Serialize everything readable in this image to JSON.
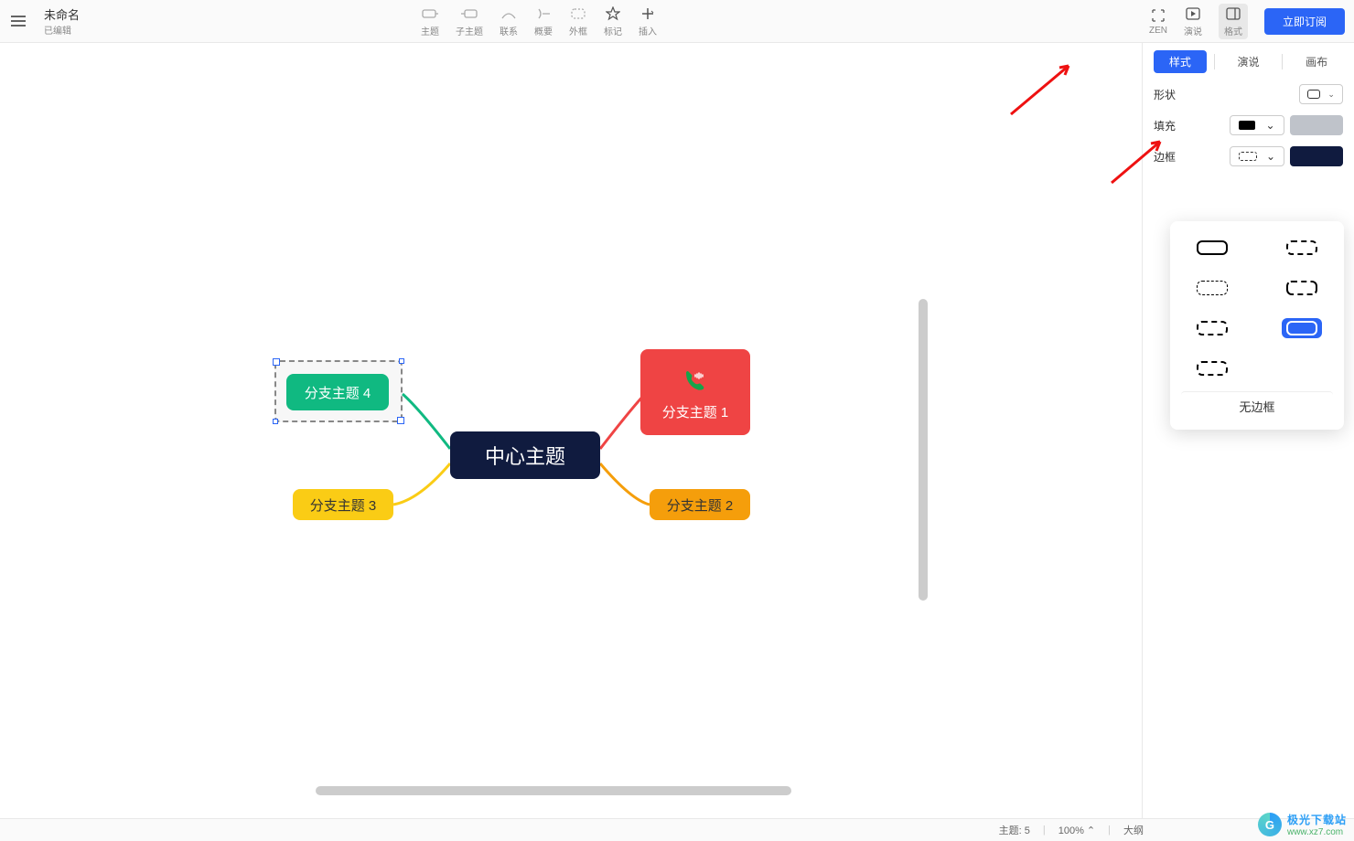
{
  "window": {
    "minimize": "—",
    "maximize": "▢",
    "close": "✕"
  },
  "header": {
    "title": "未命名",
    "subtitle": "已编辑"
  },
  "toolbar": {
    "topic": "主题",
    "subtopic": "子主题",
    "relation": "联系",
    "summary": "概要",
    "boundary": "外框",
    "marker": "标记",
    "insert": "插入"
  },
  "toolbar_right": {
    "zen": "ZEN",
    "present": "演说",
    "format": "格式",
    "subscribe": "立即订阅"
  },
  "panel": {
    "tabs": {
      "style": "样式",
      "present": "演说",
      "canvas": "画布"
    },
    "shape_label": "形状",
    "fill_label": "填充",
    "border_label": "边框"
  },
  "popover": {
    "no_border": "无边框"
  },
  "mindmap": {
    "center": "中心主题",
    "branch1": "分支主题 1",
    "branch2": "分支主题 2",
    "branch3": "分支主题 3",
    "branch4": "分支主题 4"
  },
  "statusbar": {
    "topics_label": "主题:",
    "topics_count": "5",
    "zoom": "100%",
    "outline": "大纲"
  },
  "watermark": {
    "name": "极光下载站",
    "url": "www.xz7.com"
  },
  "colors": {
    "fill_swatch": "#bfc3ca",
    "border_swatch": "#101b3f"
  }
}
